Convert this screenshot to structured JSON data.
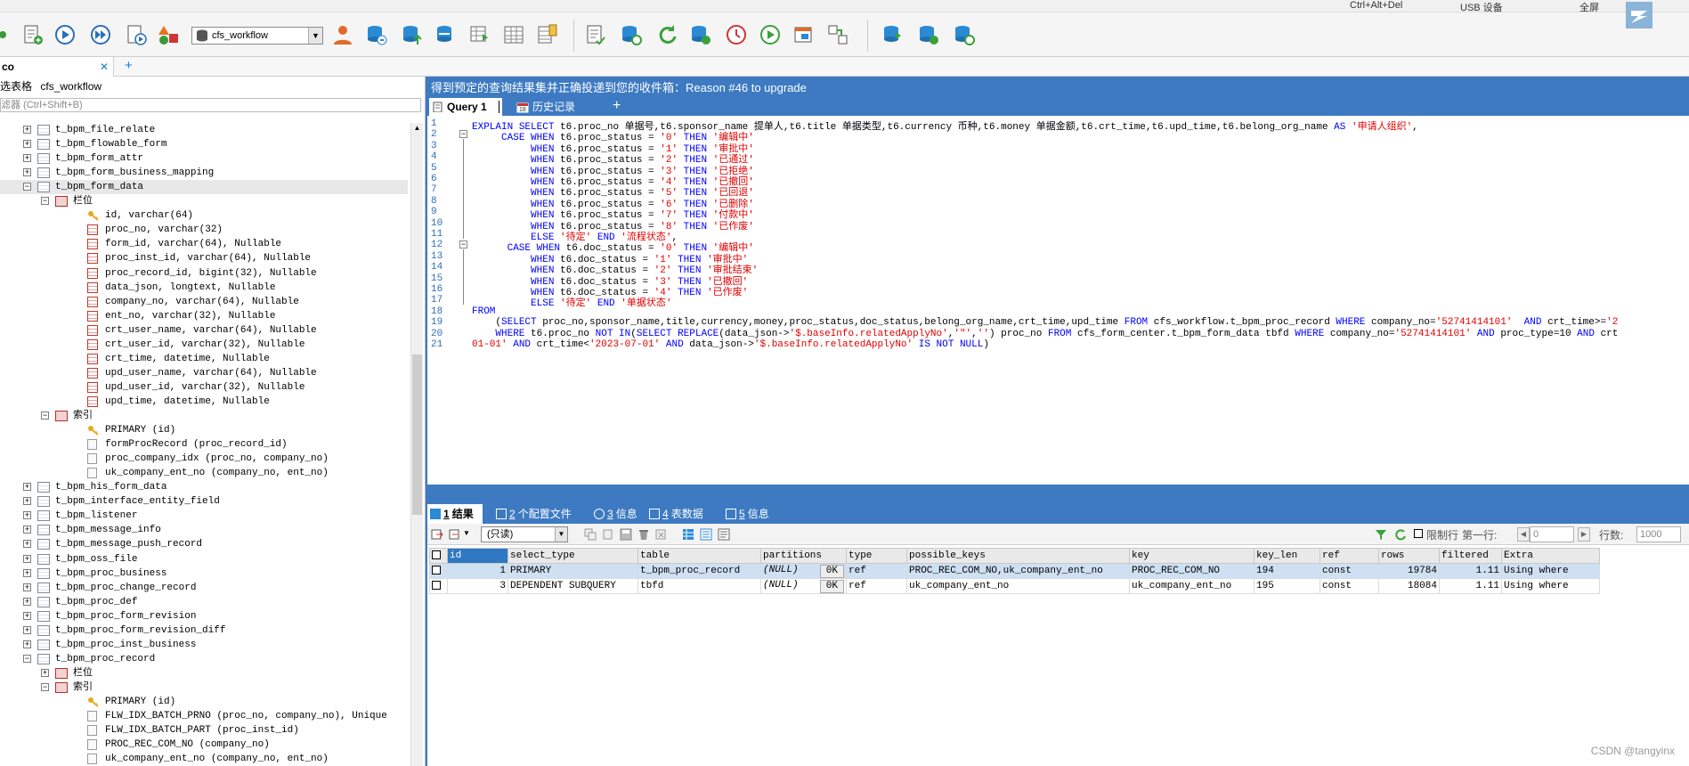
{
  "topstrip": {
    "shortcut": "Ctrl+Alt+Del",
    "usb": "USB 设备",
    "fullscreen": "全屏"
  },
  "toolbar": {
    "database": "cfs_workflow"
  },
  "tab": {
    "label": "co",
    "close": "✕",
    "add": "+"
  },
  "left": {
    "header_label": "选表格",
    "header_db": "cfs_workflow",
    "filter_placeholder": "滤器 (Ctrl+Shift+B)",
    "tree": [
      {
        "indent": 0,
        "exp": "+",
        "icon": "table",
        "label": "t_bpm_file_relate"
      },
      {
        "indent": 0,
        "exp": "+",
        "icon": "table",
        "label": "t_bpm_flowable_form"
      },
      {
        "indent": 0,
        "exp": "+",
        "icon": "table",
        "label": "t_bpm_form_attr"
      },
      {
        "indent": 0,
        "exp": "+",
        "icon": "table",
        "label": "t_bpm_form_business_mapping"
      },
      {
        "indent": 0,
        "exp": "-",
        "icon": "table",
        "label": "t_bpm_form_data",
        "selected": true
      },
      {
        "indent": 1,
        "exp": "-",
        "icon": "cols",
        "label": "栏位"
      },
      {
        "indent": 2,
        "exp": "",
        "icon": "key",
        "label": "id, varchar(64)"
      },
      {
        "indent": 2,
        "exp": "",
        "icon": "col",
        "label": "proc_no, varchar(32)"
      },
      {
        "indent": 2,
        "exp": "",
        "icon": "col",
        "label": "form_id, varchar(64), Nullable"
      },
      {
        "indent": 2,
        "exp": "",
        "icon": "col",
        "label": "proc_inst_id, varchar(64), Nullable"
      },
      {
        "indent": 2,
        "exp": "",
        "icon": "col",
        "label": "proc_record_id, bigint(32), Nullable"
      },
      {
        "indent": 2,
        "exp": "",
        "icon": "col",
        "label": "data_json, longtext, Nullable"
      },
      {
        "indent": 2,
        "exp": "",
        "icon": "col",
        "label": "company_no, varchar(64), Nullable"
      },
      {
        "indent": 2,
        "exp": "",
        "icon": "col",
        "label": "ent_no, varchar(32), Nullable"
      },
      {
        "indent": 2,
        "exp": "",
        "icon": "col",
        "label": "crt_user_name, varchar(64), Nullable"
      },
      {
        "indent": 2,
        "exp": "",
        "icon": "col",
        "label": "crt_user_id, varchar(32), Nullable"
      },
      {
        "indent": 2,
        "exp": "",
        "icon": "col",
        "label": "crt_time, datetime, Nullable"
      },
      {
        "indent": 2,
        "exp": "",
        "icon": "col",
        "label": "upd_user_name, varchar(64), Nullable"
      },
      {
        "indent": 2,
        "exp": "",
        "icon": "col",
        "label": "upd_user_id, varchar(32), Nullable"
      },
      {
        "indent": 2,
        "exp": "",
        "icon": "col",
        "label": "upd_time, datetime, Nullable"
      },
      {
        "indent": 1,
        "exp": "-",
        "icon": "cols",
        "label": "索引"
      },
      {
        "indent": 2,
        "exp": "",
        "icon": "key",
        "label": "PRIMARY (id)"
      },
      {
        "indent": 2,
        "exp": "",
        "icon": "idx",
        "label": "formProcRecord (proc_record_id)"
      },
      {
        "indent": 2,
        "exp": "",
        "icon": "idx",
        "label": "proc_company_idx (proc_no, company_no)"
      },
      {
        "indent": 2,
        "exp": "",
        "icon": "idx",
        "label": "uk_company_ent_no (company_no, ent_no)"
      },
      {
        "indent": 0,
        "exp": "+",
        "icon": "table",
        "label": "t_bpm_his_form_data"
      },
      {
        "indent": 0,
        "exp": "+",
        "icon": "table",
        "label": "t_bpm_interface_entity_field"
      },
      {
        "indent": 0,
        "exp": "+",
        "icon": "table",
        "label": "t_bpm_listener"
      },
      {
        "indent": 0,
        "exp": "+",
        "icon": "table",
        "label": "t_bpm_message_info"
      },
      {
        "indent": 0,
        "exp": "+",
        "icon": "table",
        "label": "t_bpm_message_push_record"
      },
      {
        "indent": 0,
        "exp": "+",
        "icon": "table",
        "label": "t_bpm_oss_file"
      },
      {
        "indent": 0,
        "exp": "+",
        "icon": "table",
        "label": "t_bpm_proc_business"
      },
      {
        "indent": 0,
        "exp": "+",
        "icon": "table",
        "label": "t_bpm_proc_change_record"
      },
      {
        "indent": 0,
        "exp": "+",
        "icon": "table",
        "label": "t_bpm_proc_def"
      },
      {
        "indent": 0,
        "exp": "+",
        "icon": "table",
        "label": "t_bpm_proc_form_revision"
      },
      {
        "indent": 0,
        "exp": "+",
        "icon": "table",
        "label": "t_bpm_proc_form_revision_diff"
      },
      {
        "indent": 0,
        "exp": "+",
        "icon": "table",
        "label": "t_bpm_proc_inst_business"
      },
      {
        "indent": 0,
        "exp": "-",
        "icon": "table",
        "label": "t_bpm_proc_record"
      },
      {
        "indent": 1,
        "exp": "+",
        "icon": "cols",
        "label": "栏位"
      },
      {
        "indent": 1,
        "exp": "-",
        "icon": "cols",
        "label": "索引"
      },
      {
        "indent": 2,
        "exp": "",
        "icon": "key",
        "label": "PRIMARY (id)"
      },
      {
        "indent": 2,
        "exp": "",
        "icon": "idx",
        "label": "FLW_IDX_BATCH_PRNO (proc_no, company_no), Unique"
      },
      {
        "indent": 2,
        "exp": "",
        "icon": "idx",
        "label": "FLW_IDX_BATCH_PART (proc_inst_id)"
      },
      {
        "indent": 2,
        "exp": "",
        "icon": "idx",
        "label": "PROC_REC_COM_NO (company_no)"
      },
      {
        "indent": 2,
        "exp": "",
        "icon": "idx",
        "label": "uk_company_ent_no (company_no, ent_no)"
      }
    ]
  },
  "notice": "得到预定的查询结果集并正确投递到您的收件箱：Reason #46 to upgrade",
  "query_tabs": {
    "query": "Query 1",
    "history": "历史记录",
    "add": "+"
  },
  "editor": {
    "lines": [
      [
        {
          "t": "EXPLAIN ",
          "c": "kw"
        },
        {
          "t": "SELECT ",
          "c": "kw"
        },
        {
          "t": "t6.proc_no 单据号,t6.sponsor_name 提单人,t6.title 单据类型,t6.currency 币种,t6.money 单据金额,t6.crt_time,t6.upd_time,t6.belong_org_name "
        },
        {
          "t": "AS ",
          "c": "kw"
        },
        {
          "t": "'申请人组织'",
          "c": "str"
        },
        {
          "t": ","
        }
      ],
      [
        {
          "t": "     "
        },
        {
          "t": "CASE WHEN ",
          "c": "kw"
        },
        {
          "t": "t6.proc_status = "
        },
        {
          "t": "'0' ",
          "c": "str"
        },
        {
          "t": "THEN ",
          "c": "kw"
        },
        {
          "t": "'编辑中'",
          "c": "str"
        }
      ],
      [
        {
          "t": "          "
        },
        {
          "t": "WHEN ",
          "c": "kw"
        },
        {
          "t": "t6.proc_status = "
        },
        {
          "t": "'1' ",
          "c": "str"
        },
        {
          "t": "THEN ",
          "c": "kw"
        },
        {
          "t": "'审批中'",
          "c": "str"
        }
      ],
      [
        {
          "t": "          "
        },
        {
          "t": "WHEN ",
          "c": "kw"
        },
        {
          "t": "t6.proc_status = "
        },
        {
          "t": "'2' ",
          "c": "str"
        },
        {
          "t": "THEN ",
          "c": "kw"
        },
        {
          "t": "'已通过'",
          "c": "str"
        }
      ],
      [
        {
          "t": "          "
        },
        {
          "t": "WHEN ",
          "c": "kw"
        },
        {
          "t": "t6.proc_status = "
        },
        {
          "t": "'3' ",
          "c": "str"
        },
        {
          "t": "THEN ",
          "c": "kw"
        },
        {
          "t": "'已拒绝'",
          "c": "str"
        }
      ],
      [
        {
          "t": "          "
        },
        {
          "t": "WHEN ",
          "c": "kw"
        },
        {
          "t": "t6.proc_status = "
        },
        {
          "t": "'4' ",
          "c": "str"
        },
        {
          "t": "THEN ",
          "c": "kw"
        },
        {
          "t": "'已撤回'",
          "c": "str"
        }
      ],
      [
        {
          "t": "          "
        },
        {
          "t": "WHEN ",
          "c": "kw"
        },
        {
          "t": "t6.proc_status = "
        },
        {
          "t": "'5' ",
          "c": "str"
        },
        {
          "t": "THEN ",
          "c": "kw"
        },
        {
          "t": "'已回退'",
          "c": "str"
        }
      ],
      [
        {
          "t": "          "
        },
        {
          "t": "WHEN ",
          "c": "kw"
        },
        {
          "t": "t6.proc_status = "
        },
        {
          "t": "'6' ",
          "c": "str"
        },
        {
          "t": "THEN ",
          "c": "kw"
        },
        {
          "t": "'已删除'",
          "c": "str"
        }
      ],
      [
        {
          "t": "          "
        },
        {
          "t": "WHEN ",
          "c": "kw"
        },
        {
          "t": "t6.proc_status = "
        },
        {
          "t": "'7' ",
          "c": "str"
        },
        {
          "t": "THEN ",
          "c": "kw"
        },
        {
          "t": "'付款中'",
          "c": "str"
        }
      ],
      [
        {
          "t": "          "
        },
        {
          "t": "WHEN ",
          "c": "kw"
        },
        {
          "t": "t6.proc_status = "
        },
        {
          "t": "'8' ",
          "c": "str"
        },
        {
          "t": "THEN ",
          "c": "kw"
        },
        {
          "t": "'已作废'",
          "c": "str"
        }
      ],
      [
        {
          "t": "          "
        },
        {
          "t": "ELSE ",
          "c": "kw"
        },
        {
          "t": "'待定' ",
          "c": "str"
        },
        {
          "t": "END ",
          "c": "kw"
        },
        {
          "t": "'流程状态'",
          "c": "str"
        },
        {
          "t": ","
        }
      ],
      [
        {
          "t": "      "
        },
        {
          "t": "CASE WHEN ",
          "c": "kw"
        },
        {
          "t": "t6.doc_status = "
        },
        {
          "t": "'0' ",
          "c": "str"
        },
        {
          "t": "THEN ",
          "c": "kw"
        },
        {
          "t": "'编辑中'",
          "c": "str"
        }
      ],
      [
        {
          "t": "          "
        },
        {
          "t": "WHEN ",
          "c": "kw"
        },
        {
          "t": "t6.doc_status = "
        },
        {
          "t": "'1' ",
          "c": "str"
        },
        {
          "t": "THEN ",
          "c": "kw"
        },
        {
          "t": "'审批中'",
          "c": "str"
        }
      ],
      [
        {
          "t": "          "
        },
        {
          "t": "WHEN ",
          "c": "kw"
        },
        {
          "t": "t6.doc_status = "
        },
        {
          "t": "'2' ",
          "c": "str"
        },
        {
          "t": "THEN ",
          "c": "kw"
        },
        {
          "t": "'审批结束'",
          "c": "str"
        }
      ],
      [
        {
          "t": "          "
        },
        {
          "t": "WHEN ",
          "c": "kw"
        },
        {
          "t": "t6.doc_status = "
        },
        {
          "t": "'3' ",
          "c": "str"
        },
        {
          "t": "THEN ",
          "c": "kw"
        },
        {
          "t": "'已撤回'",
          "c": "str"
        }
      ],
      [
        {
          "t": "          "
        },
        {
          "t": "WHEN ",
          "c": "kw"
        },
        {
          "t": "t6.doc_status = "
        },
        {
          "t": "'4' ",
          "c": "str"
        },
        {
          "t": "THEN ",
          "c": "kw"
        },
        {
          "t": "'已作废'",
          "c": "str"
        }
      ],
      [
        {
          "t": "          "
        },
        {
          "t": "ELSE ",
          "c": "kw"
        },
        {
          "t": "'待定' ",
          "c": "str"
        },
        {
          "t": "END ",
          "c": "kw"
        },
        {
          "t": "'单据状态'",
          "c": "str"
        }
      ],
      [
        {
          "t": "FROM",
          "c": "kw"
        }
      ],
      [
        {
          "t": "    ("
        },
        {
          "t": "SELECT ",
          "c": "kw"
        },
        {
          "t": "proc_no,sponsor_name,title,currency,money,proc_status,doc_status,belong_org_name,crt_time,upd_time "
        },
        {
          "t": "FROM ",
          "c": "kw"
        },
        {
          "t": "cfs_workflow.t_bpm_proc_record "
        },
        {
          "t": "WHERE ",
          "c": "kw"
        },
        {
          "t": "company_no="
        },
        {
          "t": "'52741414101'",
          "c": "str"
        },
        {
          "t": "  "
        },
        {
          "t": "AND ",
          "c": "kw"
        },
        {
          "t": "crt_time>="
        },
        {
          "t": "'2",
          "c": "str"
        }
      ],
      [
        {
          "t": "    "
        },
        {
          "t": "WHERE ",
          "c": "kw"
        },
        {
          "t": "t6.proc_no "
        },
        {
          "t": "NOT IN",
          "c": "kw"
        },
        {
          "t": "("
        },
        {
          "t": "SELECT REPLACE",
          "c": "kw"
        },
        {
          "t": "(data_json->"
        },
        {
          "t": "'$.baseInfo.relatedApplyNo'",
          "c": "str"
        },
        {
          "t": ","
        },
        {
          "t": "'\"'",
          "c": "str"
        },
        {
          "t": ","
        },
        {
          "t": "''",
          "c": "str"
        },
        {
          "t": ") proc_no "
        },
        {
          "t": "FROM ",
          "c": "kw"
        },
        {
          "t": "cfs_form_center.t_bpm_form_data tbfd "
        },
        {
          "t": "WHERE ",
          "c": "kw"
        },
        {
          "t": "company_no="
        },
        {
          "t": "'52741414101'",
          "c": "str"
        },
        {
          "t": " "
        },
        {
          "t": "AND ",
          "c": "kw"
        },
        {
          "t": "proc_type=10 "
        },
        {
          "t": "AND ",
          "c": "kw"
        },
        {
          "t": "crt"
        }
      ],
      [
        {
          "t": "01-01' ",
          "c": "str"
        },
        {
          "t": "AND ",
          "c": "kw"
        },
        {
          "t": "crt_time<"
        },
        {
          "t": "'2023-07-01' ",
          "c": "str"
        },
        {
          "t": "AND ",
          "c": "kw"
        },
        {
          "t": "data_json->"
        },
        {
          "t": "'$.baseInfo.relatedApplyNo' ",
          "c": "str"
        },
        {
          "t": "IS NOT NULL",
          "c": "kw"
        },
        {
          "t": ")"
        }
      ]
    ]
  },
  "result_tabs": [
    {
      "num": "1",
      "label": "结果"
    },
    {
      "num": "2",
      "label": "个配置文件"
    },
    {
      "num": "3",
      "label": "信息"
    },
    {
      "num": "4",
      "label": "表数据"
    },
    {
      "num": "5",
      "label": "信息"
    }
  ],
  "result_toolbar": {
    "mode": "(只读)",
    "limit_label": "限制行",
    "first_row_label": "第一行:",
    "first_row_value": "0",
    "rows_label": "行数:",
    "rows_value": "1000"
  },
  "result_grid": {
    "columns": [
      "id",
      "select_type",
      "table",
      "partitions",
      "type",
      "possible_keys",
      "key",
      "key_len",
      "ref",
      "rows",
      "filtered",
      "Extra"
    ],
    "rows": [
      [
        "1",
        "PRIMARY",
        "t_bpm_proc_record",
        "(NULL)",
        "ref",
        "PROC_REC_COM_NO,uk_company_ent_no",
        "PROC_REC_COM_NO",
        "194",
        "const",
        "19784",
        "1.11",
        "Using where"
      ],
      [
        "3",
        "DEPENDENT SUBQUERY",
        "tbfd",
        "(NULL)",
        "ref",
        "uk_company_ent_no",
        "uk_company_ent_no",
        "195",
        "const",
        "18084",
        "1.11",
        "Using where"
      ]
    ],
    "ok_label": "0K"
  },
  "watermark": "CSDN @tangyinx",
  "colors": {
    "header_blue": "#3d7ac2",
    "keyword": "#0000ff",
    "string": "#e00000",
    "selection": "#cfe0f2"
  }
}
